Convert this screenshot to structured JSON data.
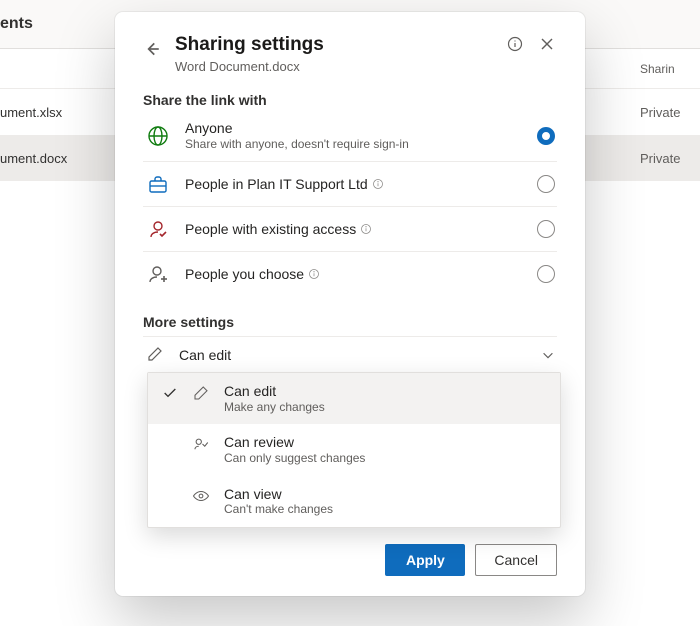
{
  "background": {
    "page_title": "ents",
    "sharing_header": "Sharin",
    "rows": [
      {
        "name": "ument.xlsx",
        "sharing": "Private",
        "selected": false
      },
      {
        "name": "ument.docx",
        "sharing": "Private",
        "selected": true
      }
    ]
  },
  "dialog": {
    "title": "Sharing settings",
    "subtitle": "Word Document.docx",
    "section_share": "Share the link with",
    "section_more": "More settings",
    "options": [
      {
        "icon": "globe",
        "icon_color": "#107c10",
        "title": "Anyone",
        "subtitle": "Share with anyone, doesn't require sign-in",
        "info": false,
        "selected": true
      },
      {
        "icon": "briefcase",
        "icon_color": "#0f6cbd",
        "title": "People in Plan IT Support Ltd",
        "subtitle": "",
        "info": true,
        "selected": false
      },
      {
        "icon": "person-check",
        "icon_color": "#a4262c",
        "title": "People with existing access",
        "subtitle": "",
        "info": true,
        "selected": false
      },
      {
        "icon": "person-plus",
        "icon_color": "#605e5c",
        "title": "People you choose",
        "subtitle": "",
        "info": true,
        "selected": false
      }
    ],
    "permission_trigger": {
      "icon": "pencil",
      "label": "Can edit"
    },
    "permission_items": [
      {
        "icon": "pencil",
        "title": "Can edit",
        "subtitle": "Make any changes",
        "selected": true
      },
      {
        "icon": "review",
        "title": "Can review",
        "subtitle": "Can only suggest changes",
        "selected": false
      },
      {
        "icon": "eye",
        "title": "Can view",
        "subtitle": "Can't make changes",
        "selected": false
      }
    ],
    "buttons": {
      "apply": "Apply",
      "cancel": "Cancel"
    }
  }
}
